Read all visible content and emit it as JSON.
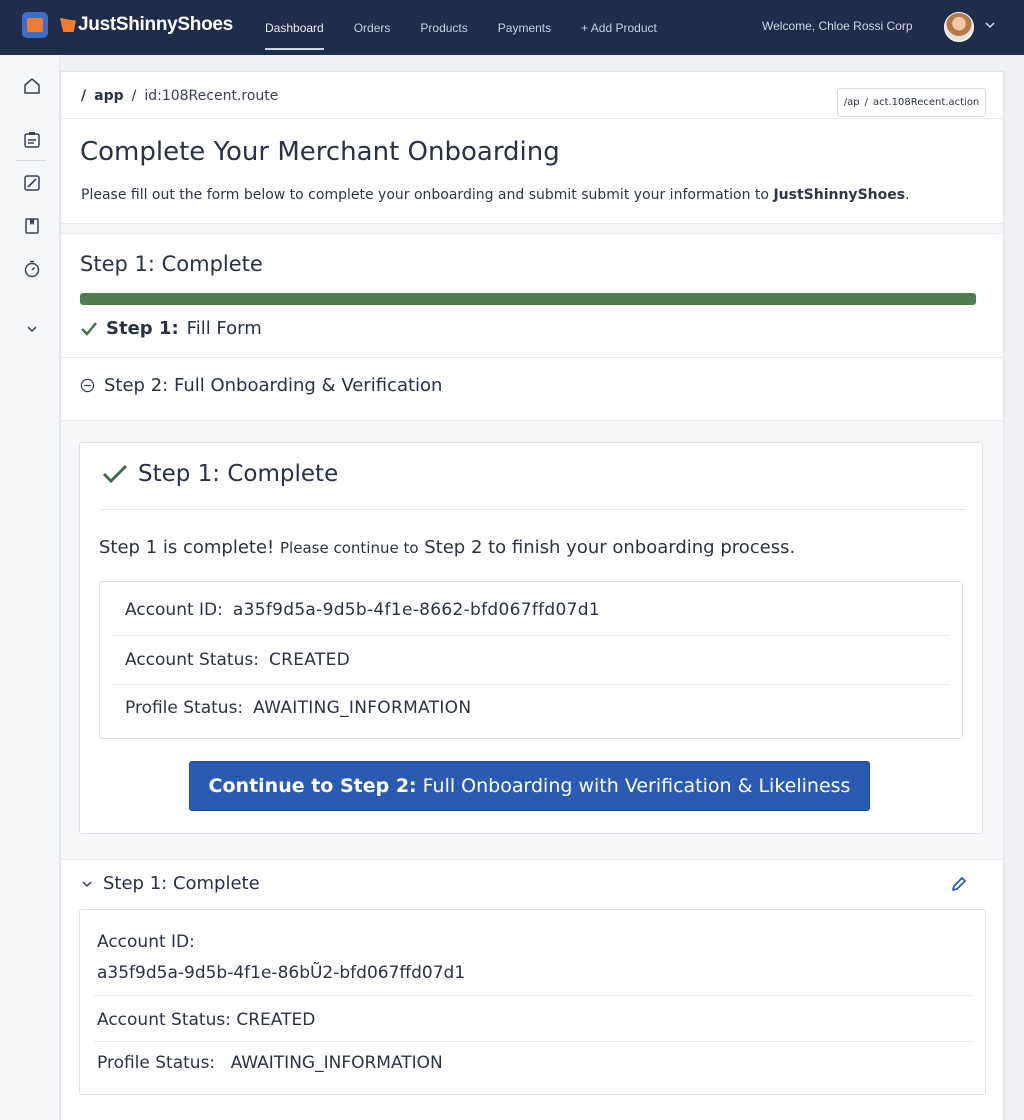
{
  "app": {
    "brand_name": "JustShinnyShoes",
    "welcome_text": "Welcome, Chloe Rossi Corp"
  },
  "nav": {
    "items": [
      {
        "label": "Dashboard",
        "active": true
      },
      {
        "label": "Orders"
      },
      {
        "label": "Products"
      },
      {
        "label": "Payments"
      },
      {
        "label": "+ Add Product"
      }
    ]
  },
  "sidebar": {
    "icons": [
      "home-icon",
      "clipboard-icon",
      "edit-box-icon",
      "bookmark-icon",
      "timer-icon",
      "chevron-down-icon"
    ]
  },
  "breadcrumb": {
    "sep1": "/",
    "root": "app",
    "sep2": "/",
    "route": "id:108Recent.route"
  },
  "action_chip": {
    "prefix": "/ap",
    "sep": "/",
    "value": "act.108Recent.action"
  },
  "header": {
    "title": "Complete Your Merchant Onboarding",
    "desc_prefix": "Please fill out the form below to complete your onboarding and submit submit your information to ",
    "desc_brand": "JustShinnyShoes",
    "desc_suffix": "."
  },
  "progress": {
    "heading": "Step 1: Complete",
    "fraction": 1.0,
    "color": "#4f7d4f"
  },
  "steps": {
    "step1_prefix": "Step 1:",
    "step1_label": "Fill Form",
    "step2_label": "Step 2:  Full Onboarding & Verification"
  },
  "card": {
    "title": "Step 1: Complete",
    "msg_part1": "Step 1 is complete!",
    "msg_part2": "Please continue to",
    "msg_part3": "Step 2 to finish your onboarding process.",
    "account_id_label": "Account ID:",
    "account_id_value": "a35f9d5a-9d5b-4f1e-8662-bfd067ffd07d1",
    "account_status_label": "Account Status:",
    "account_status_value": "CREATED",
    "profile_status_label": "Profile Status:",
    "profile_status_value": "AWAITING_INFORMATION",
    "cta_bold": "Continue to Step 2:",
    "cta_rest": "Full Onboarding with Verification & Likeliness",
    "cta_color": "#2a5bb1"
  },
  "summary": {
    "title": "Step 1: Complete",
    "account_id_label": "Account ID:",
    "account_id_value": "a35f9d5a-9d5b-4f1e-86bŨ2-bfd067ffd07d1",
    "account_status_label": "Account Status:",
    "account_status_value": "CREATED",
    "profile_status_label": "Profile Status:",
    "profile_status_value": "AWAITING_INFORMATION"
  }
}
